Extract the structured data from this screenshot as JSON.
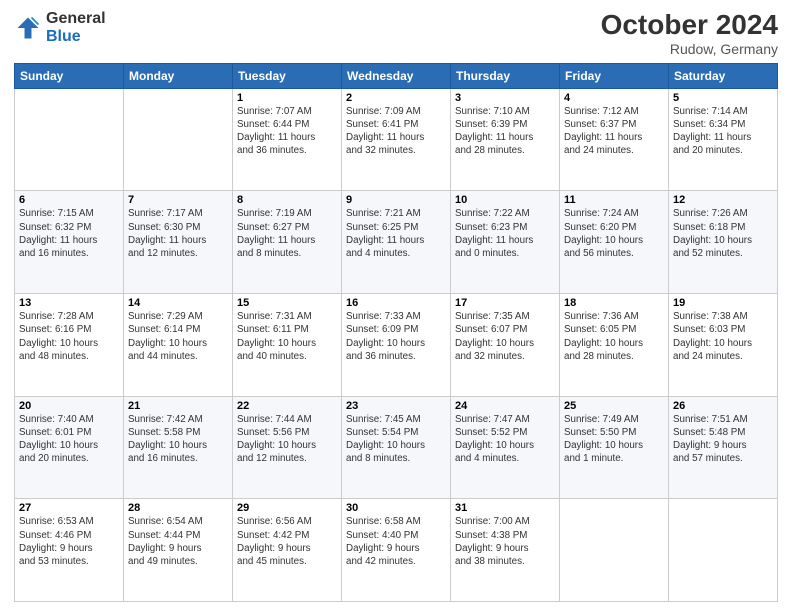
{
  "header": {
    "logo_general": "General",
    "logo_blue": "Blue",
    "month": "October 2024",
    "location": "Rudow, Germany"
  },
  "days_of_week": [
    "Sunday",
    "Monday",
    "Tuesday",
    "Wednesday",
    "Thursday",
    "Friday",
    "Saturday"
  ],
  "weeks": [
    [
      {
        "num": "",
        "detail": ""
      },
      {
        "num": "",
        "detail": ""
      },
      {
        "num": "1",
        "detail": "Sunrise: 7:07 AM\nSunset: 6:44 PM\nDaylight: 11 hours\nand 36 minutes."
      },
      {
        "num": "2",
        "detail": "Sunrise: 7:09 AM\nSunset: 6:41 PM\nDaylight: 11 hours\nand 32 minutes."
      },
      {
        "num": "3",
        "detail": "Sunrise: 7:10 AM\nSunset: 6:39 PM\nDaylight: 11 hours\nand 28 minutes."
      },
      {
        "num": "4",
        "detail": "Sunrise: 7:12 AM\nSunset: 6:37 PM\nDaylight: 11 hours\nand 24 minutes."
      },
      {
        "num": "5",
        "detail": "Sunrise: 7:14 AM\nSunset: 6:34 PM\nDaylight: 11 hours\nand 20 minutes."
      }
    ],
    [
      {
        "num": "6",
        "detail": "Sunrise: 7:15 AM\nSunset: 6:32 PM\nDaylight: 11 hours\nand 16 minutes."
      },
      {
        "num": "7",
        "detail": "Sunrise: 7:17 AM\nSunset: 6:30 PM\nDaylight: 11 hours\nand 12 minutes."
      },
      {
        "num": "8",
        "detail": "Sunrise: 7:19 AM\nSunset: 6:27 PM\nDaylight: 11 hours\nand 8 minutes."
      },
      {
        "num": "9",
        "detail": "Sunrise: 7:21 AM\nSunset: 6:25 PM\nDaylight: 11 hours\nand 4 minutes."
      },
      {
        "num": "10",
        "detail": "Sunrise: 7:22 AM\nSunset: 6:23 PM\nDaylight: 11 hours\nand 0 minutes."
      },
      {
        "num": "11",
        "detail": "Sunrise: 7:24 AM\nSunset: 6:20 PM\nDaylight: 10 hours\nand 56 minutes."
      },
      {
        "num": "12",
        "detail": "Sunrise: 7:26 AM\nSunset: 6:18 PM\nDaylight: 10 hours\nand 52 minutes."
      }
    ],
    [
      {
        "num": "13",
        "detail": "Sunrise: 7:28 AM\nSunset: 6:16 PM\nDaylight: 10 hours\nand 48 minutes."
      },
      {
        "num": "14",
        "detail": "Sunrise: 7:29 AM\nSunset: 6:14 PM\nDaylight: 10 hours\nand 44 minutes."
      },
      {
        "num": "15",
        "detail": "Sunrise: 7:31 AM\nSunset: 6:11 PM\nDaylight: 10 hours\nand 40 minutes."
      },
      {
        "num": "16",
        "detail": "Sunrise: 7:33 AM\nSunset: 6:09 PM\nDaylight: 10 hours\nand 36 minutes."
      },
      {
        "num": "17",
        "detail": "Sunrise: 7:35 AM\nSunset: 6:07 PM\nDaylight: 10 hours\nand 32 minutes."
      },
      {
        "num": "18",
        "detail": "Sunrise: 7:36 AM\nSunset: 6:05 PM\nDaylight: 10 hours\nand 28 minutes."
      },
      {
        "num": "19",
        "detail": "Sunrise: 7:38 AM\nSunset: 6:03 PM\nDaylight: 10 hours\nand 24 minutes."
      }
    ],
    [
      {
        "num": "20",
        "detail": "Sunrise: 7:40 AM\nSunset: 6:01 PM\nDaylight: 10 hours\nand 20 minutes."
      },
      {
        "num": "21",
        "detail": "Sunrise: 7:42 AM\nSunset: 5:58 PM\nDaylight: 10 hours\nand 16 minutes."
      },
      {
        "num": "22",
        "detail": "Sunrise: 7:44 AM\nSunset: 5:56 PM\nDaylight: 10 hours\nand 12 minutes."
      },
      {
        "num": "23",
        "detail": "Sunrise: 7:45 AM\nSunset: 5:54 PM\nDaylight: 10 hours\nand 8 minutes."
      },
      {
        "num": "24",
        "detail": "Sunrise: 7:47 AM\nSunset: 5:52 PM\nDaylight: 10 hours\nand 4 minutes."
      },
      {
        "num": "25",
        "detail": "Sunrise: 7:49 AM\nSunset: 5:50 PM\nDaylight: 10 hours\nand 1 minute."
      },
      {
        "num": "26",
        "detail": "Sunrise: 7:51 AM\nSunset: 5:48 PM\nDaylight: 9 hours\nand 57 minutes."
      }
    ],
    [
      {
        "num": "27",
        "detail": "Sunrise: 6:53 AM\nSunset: 4:46 PM\nDaylight: 9 hours\nand 53 minutes."
      },
      {
        "num": "28",
        "detail": "Sunrise: 6:54 AM\nSunset: 4:44 PM\nDaylight: 9 hours\nand 49 minutes."
      },
      {
        "num": "29",
        "detail": "Sunrise: 6:56 AM\nSunset: 4:42 PM\nDaylight: 9 hours\nand 45 minutes."
      },
      {
        "num": "30",
        "detail": "Sunrise: 6:58 AM\nSunset: 4:40 PM\nDaylight: 9 hours\nand 42 minutes."
      },
      {
        "num": "31",
        "detail": "Sunrise: 7:00 AM\nSunset: 4:38 PM\nDaylight: 9 hours\nand 38 minutes."
      },
      {
        "num": "",
        "detail": ""
      },
      {
        "num": "",
        "detail": ""
      }
    ]
  ]
}
